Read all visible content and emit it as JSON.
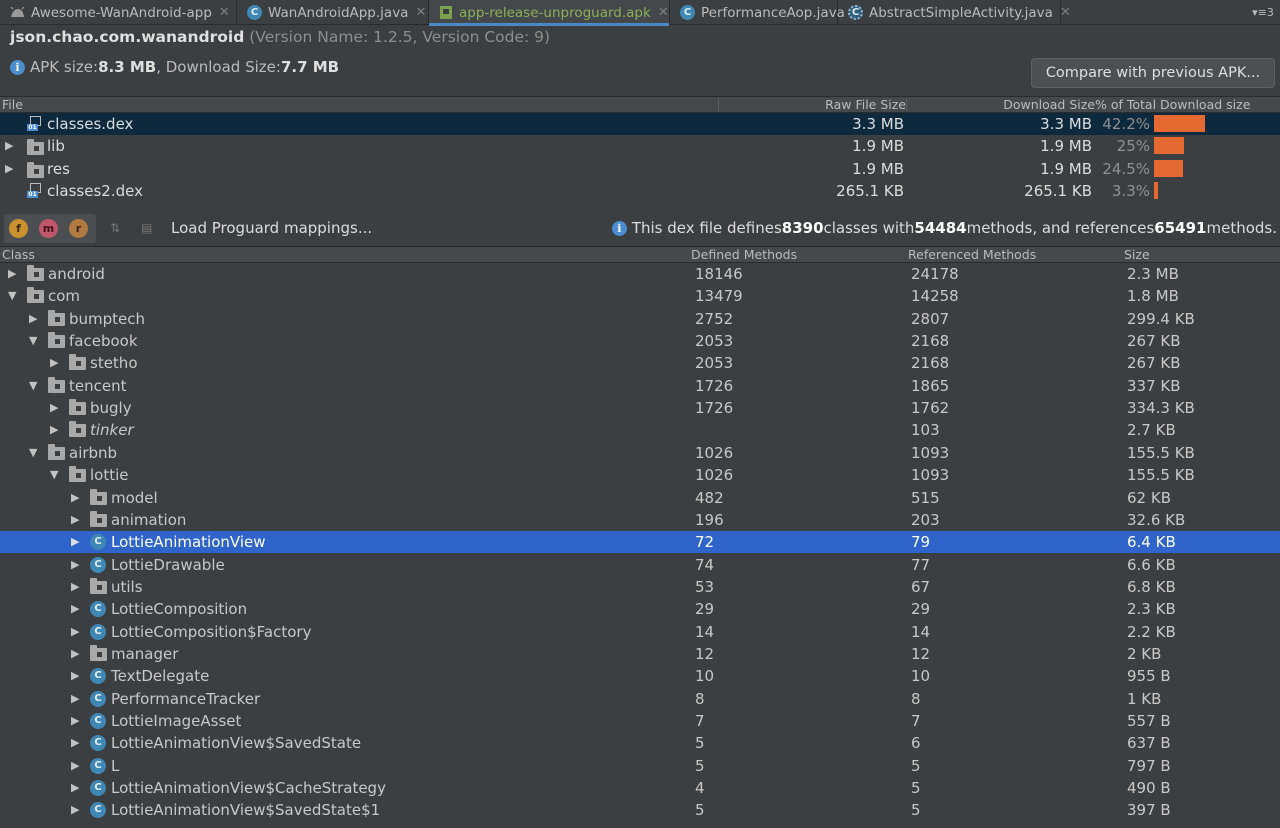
{
  "tabs": [
    {
      "label": "Awesome-WanAndroid-app",
      "icon": "android-icon"
    },
    {
      "label": "WanAndroidApp.java",
      "icon": "class-c-icon"
    },
    {
      "label": "app-release-unproguard.apk",
      "icon": "apk-icon",
      "active": true
    },
    {
      "label": "PerformanceAop.java",
      "icon": "class-c-icon"
    },
    {
      "label": "AbstractSimpleActivity.java",
      "icon": "abstract-class-icon"
    }
  ],
  "tab_overflow": "▾≡3",
  "header": {
    "package": "json.chao.com.wanandroid",
    "version": "(Version Name: 1.2.5, Version Code: 9)",
    "apk_label": "APK size: ",
    "apk_size": "8.3 MB",
    "download_label": ", Download Size: ",
    "download_size": "7.7 MB",
    "compare_button": "Compare with previous APK..."
  },
  "file_table": {
    "headers": {
      "file": "File",
      "raw": "Raw File Size",
      "download": "Download Size",
      "percent": "% of Total Download size"
    },
    "rows": [
      {
        "name": "classes.dex",
        "raw": "3.3 MB",
        "download": "3.3 MB",
        "percent": "42.2%",
        "pct_value": 42.2,
        "icon": "dex-file-icon",
        "expandable": false,
        "selected": true
      },
      {
        "name": "lib",
        "raw": "1.9 MB",
        "download": "1.9 MB",
        "percent": "25%",
        "pct_value": 25,
        "icon": "folder-icon",
        "expandable": true
      },
      {
        "name": "res",
        "raw": "1.9 MB",
        "download": "1.9 MB",
        "percent": "24.5%",
        "pct_value": 24.5,
        "icon": "res-folder-icon",
        "expandable": true
      },
      {
        "name": "classes2.dex",
        "raw": "265.1 KB",
        "download": "265.1 KB",
        "percent": "3.3%",
        "pct_value": 3.3,
        "icon": "dex-file-icon",
        "expandable": false
      }
    ]
  },
  "toolbar": {
    "buttons": [
      "f",
      "m",
      "r"
    ],
    "load_mappings": "Load Proguard mappings...",
    "dex_info_1": "This dex file defines ",
    "classes_count": "8390",
    "dex_info_2": " classes with ",
    "methods_count": "54484",
    "dex_info_3": " methods, and references ",
    "refs_count": "65491",
    "dex_info_4": " methods."
  },
  "class_table": {
    "headers": {
      "class": "Class",
      "defined": "Defined Methods",
      "referenced": "Referenced Methods",
      "size": "Size"
    },
    "rows": [
      {
        "name": "android",
        "depth": 0,
        "type": "package",
        "expanded": false,
        "defined": "18146",
        "referenced": "24178",
        "size": "2.3 MB"
      },
      {
        "name": "com",
        "depth": 0,
        "type": "package",
        "expanded": true,
        "defined": "13479",
        "referenced": "14258",
        "size": "1.8 MB"
      },
      {
        "name": "bumptech",
        "depth": 1,
        "type": "package",
        "expanded": false,
        "defined": "2752",
        "referenced": "2807",
        "size": "299.4 KB"
      },
      {
        "name": "facebook",
        "depth": 1,
        "type": "package",
        "expanded": true,
        "defined": "2053",
        "referenced": "2168",
        "size": "267 KB"
      },
      {
        "name": "stetho",
        "depth": 2,
        "type": "package",
        "expanded": false,
        "defined": "2053",
        "referenced": "2168",
        "size": "267 KB"
      },
      {
        "name": "tencent",
        "depth": 1,
        "type": "package",
        "expanded": true,
        "defined": "1726",
        "referenced": "1865",
        "size": "337 KB"
      },
      {
        "name": "bugly",
        "depth": 2,
        "type": "package",
        "expanded": false,
        "defined": "1726",
        "referenced": "1762",
        "size": "334.3 KB"
      },
      {
        "name": "tinker",
        "depth": 2,
        "type": "package",
        "expanded": false,
        "italic": true,
        "defined": "",
        "referenced": "103",
        "size": "2.7 KB"
      },
      {
        "name": "airbnb",
        "depth": 1,
        "type": "package",
        "expanded": true,
        "defined": "1026",
        "referenced": "1093",
        "size": "155.5 KB"
      },
      {
        "name": "lottie",
        "depth": 2,
        "type": "package",
        "expanded": true,
        "defined": "1026",
        "referenced": "1093",
        "size": "155.5 KB"
      },
      {
        "name": "model",
        "depth": 3,
        "type": "package",
        "expanded": false,
        "defined": "482",
        "referenced": "515",
        "size": "62 KB"
      },
      {
        "name": "animation",
        "depth": 3,
        "type": "package",
        "expanded": false,
        "defined": "196",
        "referenced": "203",
        "size": "32.6 KB"
      },
      {
        "name": "LottieAnimationView",
        "depth": 3,
        "type": "class",
        "expanded": false,
        "selected": true,
        "defined": "72",
        "referenced": "79",
        "size": "6.4 KB"
      },
      {
        "name": "LottieDrawable",
        "depth": 3,
        "type": "class",
        "expanded": false,
        "defined": "74",
        "referenced": "77",
        "size": "6.6 KB"
      },
      {
        "name": "utils",
        "depth": 3,
        "type": "package",
        "expanded": false,
        "defined": "53",
        "referenced": "67",
        "size": "6.8 KB"
      },
      {
        "name": "LottieComposition",
        "depth": 3,
        "type": "class",
        "expanded": false,
        "defined": "29",
        "referenced": "29",
        "size": "2.3 KB"
      },
      {
        "name": "LottieComposition$Factory",
        "depth": 3,
        "type": "class",
        "expanded": false,
        "defined": "14",
        "referenced": "14",
        "size": "2.2 KB"
      },
      {
        "name": "manager",
        "depth": 3,
        "type": "package",
        "expanded": false,
        "defined": "12",
        "referenced": "12",
        "size": "2 KB"
      },
      {
        "name": "TextDelegate",
        "depth": 3,
        "type": "class",
        "expanded": false,
        "defined": "10",
        "referenced": "10",
        "size": "955 B"
      },
      {
        "name": "PerformanceTracker",
        "depth": 3,
        "type": "class",
        "expanded": false,
        "defined": "8",
        "referenced": "8",
        "size": "1 KB"
      },
      {
        "name": "LottieImageAsset",
        "depth": 3,
        "type": "class",
        "expanded": false,
        "defined": "7",
        "referenced": "7",
        "size": "557 B"
      },
      {
        "name": "LottieAnimationView$SavedState",
        "depth": 3,
        "type": "class",
        "expanded": false,
        "defined": "5",
        "referenced": "6",
        "size": "637 B"
      },
      {
        "name": "L",
        "depth": 3,
        "type": "class",
        "expanded": false,
        "defined": "5",
        "referenced": "5",
        "size": "797 B"
      },
      {
        "name": "LottieAnimationView$CacheStrategy",
        "depth": 3,
        "type": "class",
        "expanded": false,
        "defined": "4",
        "referenced": "5",
        "size": "490 B"
      },
      {
        "name": "LottieAnimationView$SavedState$1",
        "depth": 3,
        "type": "class",
        "expanded": false,
        "defined": "5",
        "referenced": "5",
        "size": "397 B"
      }
    ]
  }
}
